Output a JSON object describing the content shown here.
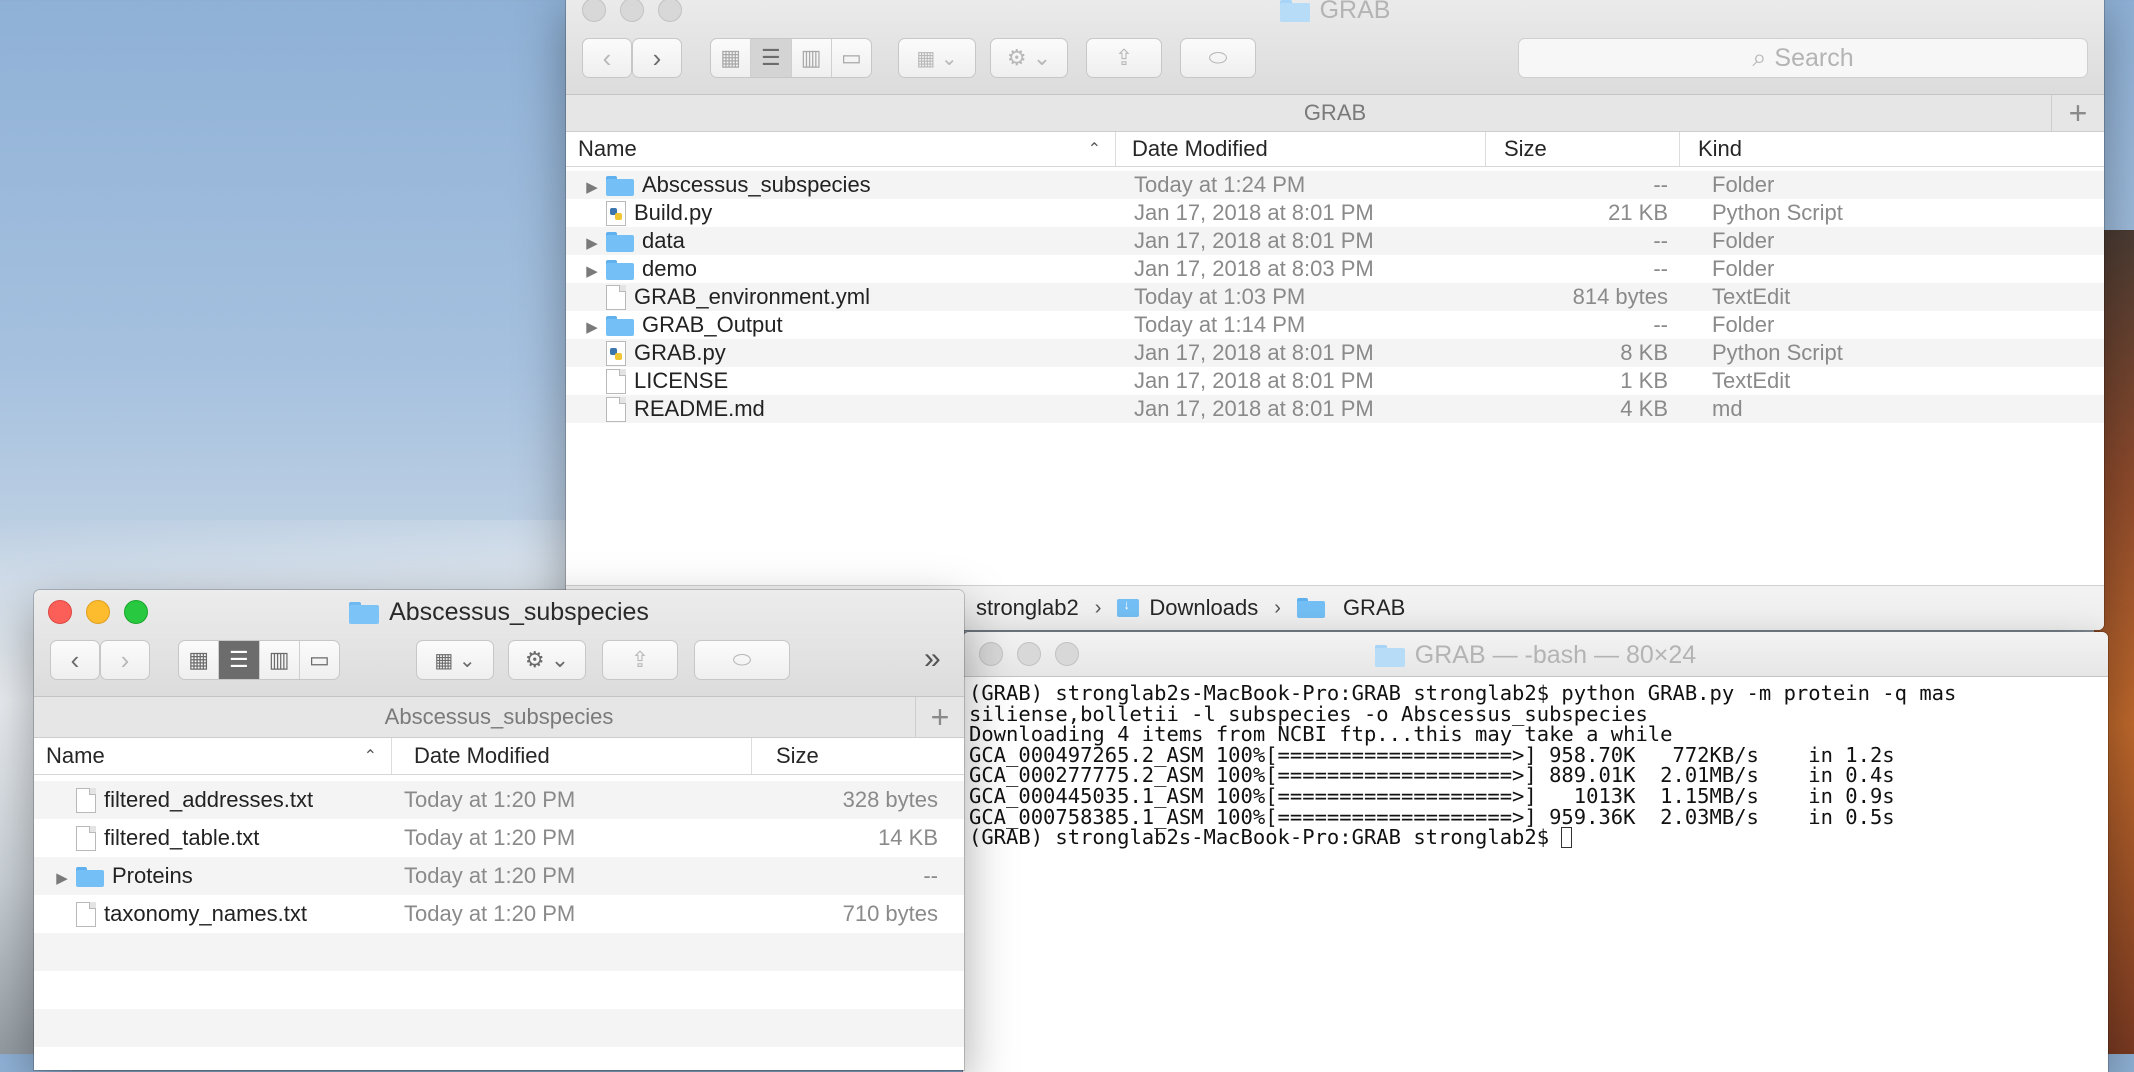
{
  "finder_main": {
    "title": "GRAB",
    "search_placeholder": "Search",
    "path_title": "GRAB",
    "columns": [
      "Name",
      "Date Modified",
      "Size",
      "Kind"
    ],
    "rows": [
      {
        "name": "Abscessus_subspecies",
        "date": "Today at 1:24 PM",
        "size": "--",
        "kind": "Folder",
        "type": "folder"
      },
      {
        "name": "Build.py",
        "date": "Jan 17, 2018 at 8:01 PM",
        "size": "21 KB",
        "kind": "Python Script",
        "type": "python"
      },
      {
        "name": "data",
        "date": "Jan 17, 2018 at 8:01 PM",
        "size": "--",
        "kind": "Folder",
        "type": "folder"
      },
      {
        "name": "demo",
        "date": "Jan 17, 2018 at 8:03 PM",
        "size": "--",
        "kind": "Folder",
        "type": "folder"
      },
      {
        "name": "GRAB_environment.yml",
        "date": "Today at 1:03 PM",
        "size": "814 bytes",
        "kind": "TextEdit",
        "type": "doc"
      },
      {
        "name": "GRAB_Output",
        "date": "Today at 1:14 PM",
        "size": "--",
        "kind": "Folder",
        "type": "folder"
      },
      {
        "name": "GRAB.py",
        "date": "Jan 17, 2018 at 8:01 PM",
        "size": "8 KB",
        "kind": "Python Script",
        "type": "python"
      },
      {
        "name": "LICENSE",
        "date": "Jan 17, 2018 at 8:01 PM",
        "size": "1 KB",
        "kind": "TextEdit",
        "type": "doc"
      },
      {
        "name": "README.md",
        "date": "Jan 17, 2018 at 8:01 PM",
        "size": "4 KB",
        "kind": "md",
        "type": "doc"
      }
    ],
    "pathbar": [
      "stronglab2",
      "Downloads",
      "GRAB"
    ]
  },
  "finder_sub": {
    "title": "Abscessus_subspecies",
    "path_title": "Abscessus_subspecies",
    "more": "»",
    "columns": [
      "Name",
      "Date Modified",
      "Size"
    ],
    "rows": [
      {
        "name": "filtered_addresses.txt",
        "date": "Today at 1:20 PM",
        "size": "328 bytes",
        "type": "doc"
      },
      {
        "name": "filtered_table.txt",
        "date": "Today at 1:20 PM",
        "size": "14 KB",
        "type": "doc"
      },
      {
        "name": "Proteins",
        "date": "Today at 1:20 PM",
        "size": "--",
        "type": "folder"
      },
      {
        "name": "taxonomy_names.txt",
        "date": "Today at 1:20 PM",
        "size": "710 bytes",
        "type": "doc"
      }
    ]
  },
  "terminal": {
    "title": "GRAB — -bash — 80×24",
    "lines": [
      "(GRAB) stronglab2s-MacBook-Pro:GRAB stronglab2$ python GRAB.py -m protein -q mas",
      "siliense,bolletii -l subspecies -o Abscessus_subspecies",
      "Downloading 4 items from NCBI ftp...this may take a while",
      "GCA_000497265.2_ASM 100%[===================>] 958.70K   772KB/s    in 1.2s",
      "GCA_000277775.2_ASM 100%[===================>] 889.01K  2.01MB/s    in 0.4s",
      "GCA_000445035.1_ASM 100%[===================>]   1013K  1.15MB/s    in 0.9s",
      "GCA_000758385.1_ASM 100%[===================>] 959.36K  2.03MB/s    in 0.5s"
    ],
    "prompt": "(GRAB) stronglab2s-MacBook-Pro:GRAB stronglab2$ "
  }
}
